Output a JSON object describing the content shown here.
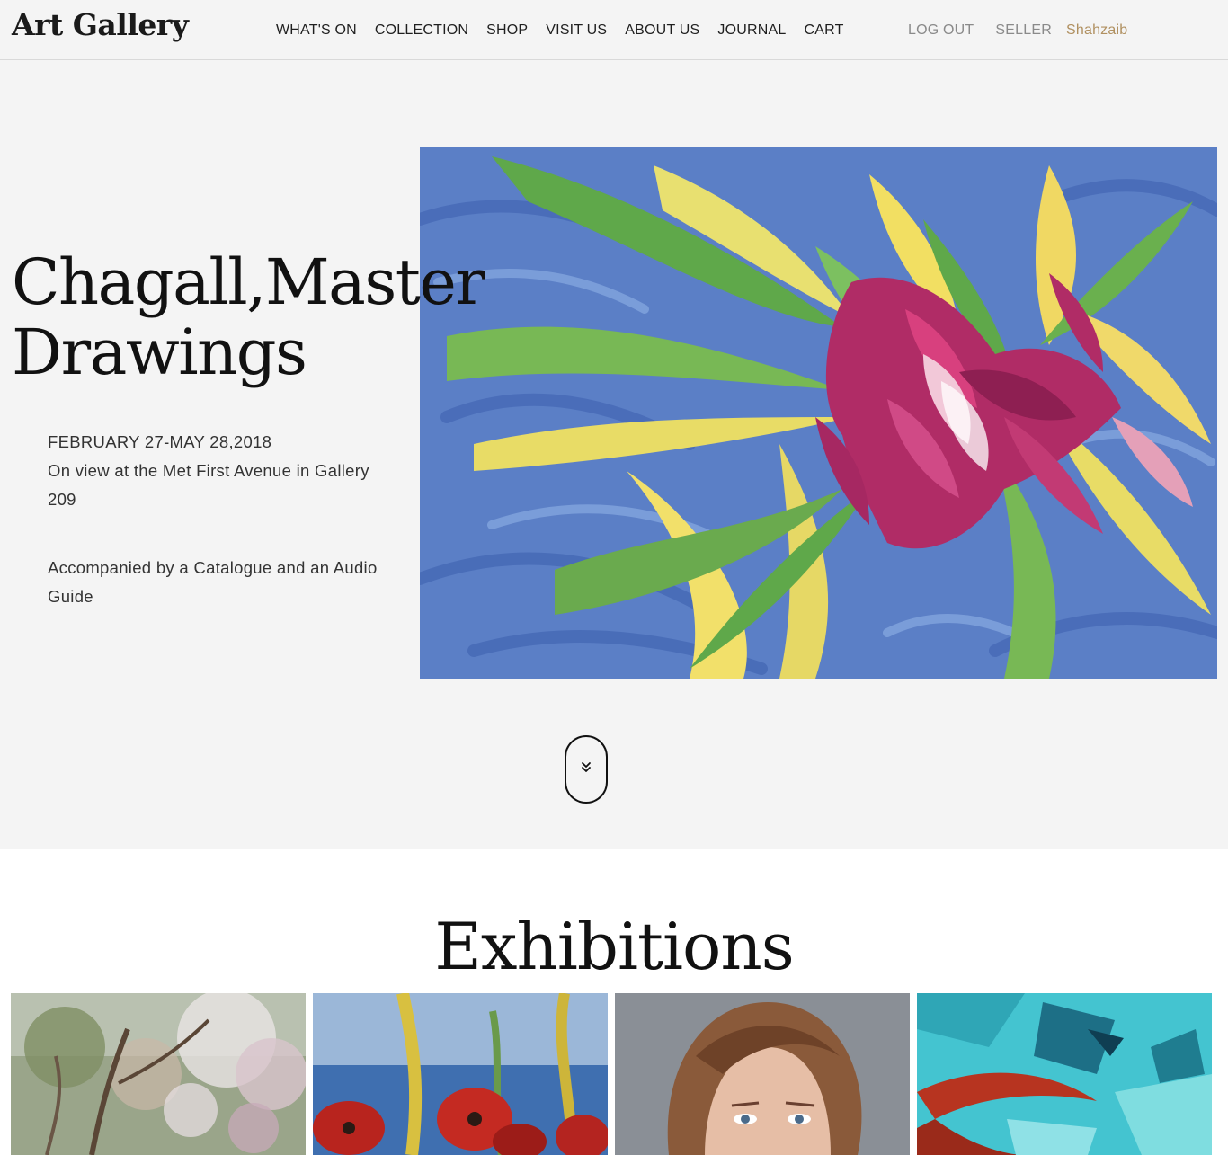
{
  "header": {
    "logo": "Art Gallery",
    "nav": [
      "WHAT'S ON",
      "COLLECTION",
      "SHOP",
      "VISIT US",
      "ABOUT US",
      "JOURNAL",
      "CART"
    ],
    "logout": "LOG OUT",
    "role": "SELLER",
    "username": "Shahzaib"
  },
  "hero": {
    "title_line1": "Chagall,Master",
    "title_line2": "Drawings",
    "dates": "FEBRUARY 27-MAY 28,2018",
    "location": "On view at the Met First Avenue in Gallery 209",
    "extras": "Accompanied by a Catalogue and an Audio Guide",
    "scroll_icon": "double-chevron-down-icon"
  },
  "exhibitions": {
    "title": "Exhibitions",
    "cards": [
      {
        "image": "blossom-tree-painting"
      },
      {
        "image": "red-poppies-painting"
      },
      {
        "image": "girl-portrait-painting"
      },
      {
        "image": "turquoise-abstract-painting"
      }
    ]
  },
  "colors": {
    "header_bg": "#f4f4f4",
    "hero_bg": "#f4f4f4",
    "nav_text": "#1f1f1f",
    "muted_text": "#8a8a8a",
    "username_accent": "#b09060"
  }
}
